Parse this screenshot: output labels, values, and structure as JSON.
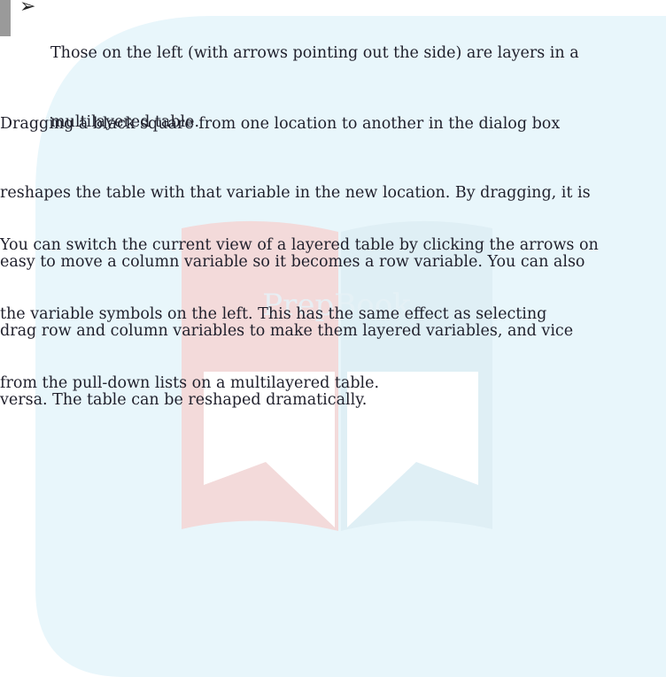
{
  "bullet": {
    "icon": "check-arrow-icon",
    "lines": [
      "Those on the left (with arrows pointing out the side) are layers in a",
      "multilayered table."
    ]
  },
  "paragraphs": [
    {
      "lines": [
        "Dragging a black square from one location to another in the dialog box",
        "reshapes the table with that variable in the new location. By dragging, it is",
        "easy to move a column variable so it becomes a row variable. You can also",
        "drag row and column variables to make them layered variables, and vice",
        "versa. The table can be reshaped dramatically."
      ]
    },
    {
      "lines": [
        "You can switch the current view of a layered table by clicking the arrows on",
        "the variable symbols on the left. This has the same effect as selecting",
        "from the pull-down lists on a multilayered table."
      ]
    }
  ],
  "watermark": {
    "text": "PrepBook",
    "colors": {
      "shield": "#e8f6fb",
      "book_left": "#f3dada",
      "book_right": "#dfeff5",
      "pages": "#ffffff"
    }
  }
}
